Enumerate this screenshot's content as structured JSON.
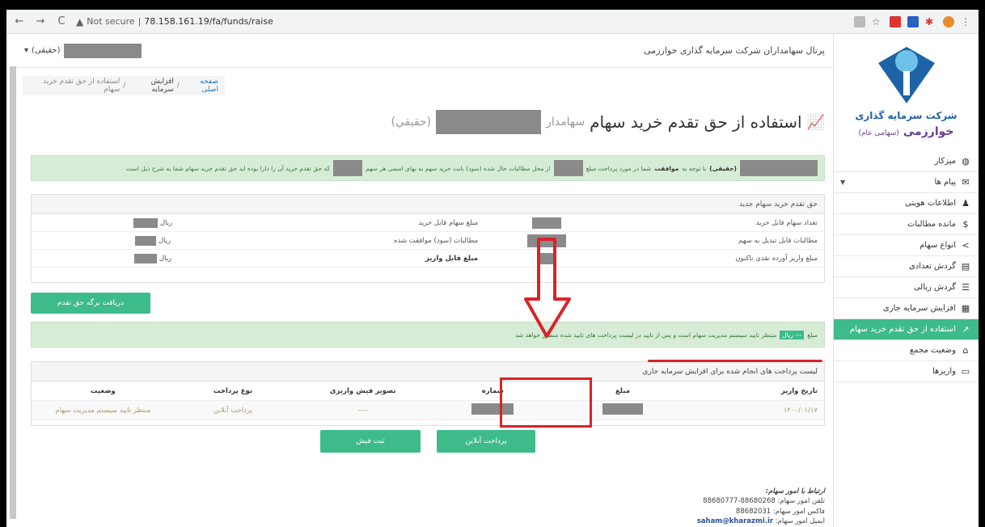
{
  "browser": {
    "back": "←",
    "forward": "→",
    "reload": "C",
    "not_secure": "Not secure",
    "url": "78.158.161.19/fa/funds/raise"
  },
  "header": {
    "portal_title": "پرتال سهامداران شرکت سرمایه گذاری خوارزمی",
    "user_suffix": "(حقیقی)",
    "user_caret": "▾"
  },
  "logo": {
    "name": "شرکت سرمایه گذاری",
    "name2": "خوارزمی",
    "sub": "(سهامی عام)"
  },
  "sidebar": {
    "items": [
      {
        "label": "میزکار",
        "icon": "dashboard-icon",
        "glyph": "◍"
      },
      {
        "label": "پیام ها",
        "icon": "envelope-icon",
        "glyph": "✉"
      },
      {
        "label": "اطلاعات هویتی",
        "icon": "user-icon",
        "glyph": "♟"
      },
      {
        "label": "مانده مطالبات",
        "icon": "dollar-icon",
        "glyph": "$"
      },
      {
        "label": "انواع سهام",
        "icon": "share-icon",
        "glyph": "<"
      },
      {
        "label": "گردش تعدادی",
        "icon": "table-icon",
        "glyph": "▤"
      },
      {
        "label": "گردش ریالی",
        "icon": "list-icon",
        "glyph": "☰"
      },
      {
        "label": "افزایش سرمایه جاری",
        "icon": "calculator-icon",
        "glyph": "▦"
      },
      {
        "label": "استفاده از حق تقدم خرید سهام",
        "icon": "chart-line-icon",
        "glyph": "↗"
      },
      {
        "label": "وضعیت مجمع",
        "icon": "bank-icon",
        "glyph": "⌂"
      },
      {
        "label": "واریزها",
        "icon": "card-icon",
        "glyph": "▭"
      }
    ]
  },
  "breadcrumb": {
    "home": "صفحه اصلی",
    "sep1": "/",
    "raise": "افزایش سرمایه",
    "sep2": "/",
    "current": "استفاده از حق تقدم خرید سهام"
  },
  "page": {
    "title": "استفاده از حق تقدم خرید سهام",
    "title_suffix": "سهامدار",
    "title_type": "(حقيقي)"
  },
  "alert1": {
    "prefix": "(حقیقی)",
    "bold": "موافقت",
    "text1": "با توجه به",
    "text2": "شما در مورد پرداخت مبلغ",
    "text3": "از محل مطالبات حال شده (سود) بابت خرید سهم به بهای اسمی هر سهم",
    "text4": "که حق تقدم خرید آن را دارا بوده اید حق تقدم خرید سهام شما به شرح ذیل است"
  },
  "info": {
    "heading": "حق تقدم خرید سهام جدید",
    "rows": [
      {
        "label": "تعداد سهام قابل خرید",
        "label2": "مبلغ سهام قابل خرید",
        "unit": "ریال"
      },
      {
        "label": "مطالبات قابل تبدیل به سهم",
        "label2": "مطالبات (سود) موافقت شده",
        "unit": "ریال"
      },
      {
        "label": "مبلغ واریز آورده نقدی تاکنون",
        "label2": "مبلغ قابل واریز",
        "unit": "ریال"
      }
    ],
    "button": "دریافت برگه حق تقدم"
  },
  "alert2": {
    "prefix": "مبلغ",
    "badge": "--- ریال",
    "text": "منتظر تایید سیستم مدیریت سهام است و پس از تایید در لیست پرداخت های تایید شده منظور خواهد شد"
  },
  "payments": {
    "heading": "لیست پرداخت های انجام شده برای افزایش سرمایه جاری",
    "columns": [
      "تاریخ واریز",
      "مبلغ",
      "شماره",
      "تصویر فیش واریزی",
      "نوع پرداخت",
      "وضعیت"
    ],
    "row": {
      "date": "۱۴۰۰/۰۱/۱۷",
      "image": "----",
      "type": "پرداخت آنلاین",
      "status": "منتظر تایید سیستم مدیریت سهام"
    }
  },
  "actions": {
    "online_pay": "پرداخت آنلاین",
    "register_receipt": "ثبت فیش"
  },
  "footer": {
    "title": "ارتباط با امور سهام:",
    "phone_label": "تلفن امور سهام:",
    "phone": "88680268-88680777",
    "fax_label": "فاکس امور سهام:",
    "fax": "88682031",
    "email_label": "ایمیل امور سهام:",
    "email": "saham@kharazmi.ir"
  },
  "colors": {
    "accent": "#3dbb8a",
    "annotation": "#d8232a",
    "brand_blue": "#1e63a6",
    "brand_purple": "#6a3b94"
  }
}
